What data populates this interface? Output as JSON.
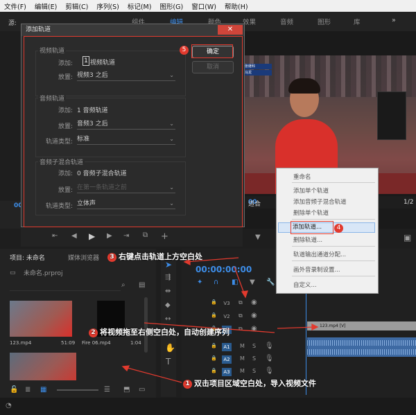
{
  "menubar": [
    "文件(F)",
    "编辑(E)",
    "剪辑(C)",
    "序列(S)",
    "标记(M)",
    "图形(G)",
    "窗口(W)",
    "帮助(H)"
  ],
  "workspace_tabs": {
    "items": [
      "组件",
      "编辑",
      "颜色",
      "效果",
      "音频",
      "图形",
      "库"
    ],
    "active": "编辑"
  },
  "source_tab": "源:",
  "dialog": {
    "title": "添加轨道",
    "close": "✕",
    "video": {
      "title": "视频轨道",
      "add_label": "添加:",
      "add_count": "1",
      "add_unit": "视频轨道",
      "place_label": "放置:",
      "place_value": "视频3 之后"
    },
    "audio": {
      "title": "音频轨道",
      "add_label": "添加:",
      "add_text": "1 音频轨道",
      "place_label": "放置:",
      "place_value": "音频3 之后",
      "type_label": "轨道类型:",
      "type_value": "标准"
    },
    "submix": {
      "title": "音频子混合轨道",
      "add_label": "添加:",
      "add_text": "0 音频子混合轨道",
      "place_label": "放置:",
      "place_value": "在第一条轨道之前",
      "type_label": "轨道类型:",
      "type_value": "立体声"
    },
    "ok_button": "确定",
    "cancel_button": "取消"
  },
  "program_monitor": {
    "timecode_left": "00",
    "fit": "适合",
    "ratio": "1/2",
    "scoreboard": [
      "张继科",
      "马龙"
    ]
  },
  "context_menu": {
    "items": [
      "重命名",
      "添加单个轨道",
      "添加音频子混合轨道",
      "删除单个轨道",
      "添加轨道...",
      "删除轨道...",
      "轨道输出通道分配...",
      "画外音录制设置...",
      "自定义..."
    ],
    "highlighted": "添加轨道..."
  },
  "project_panel": {
    "tab_project": "项目: 未命名",
    "tab_media": "媒体浏览器",
    "file": "未命名.prproj",
    "clips": [
      {
        "name": "123.mp4",
        "duration": "51:09"
      },
      {
        "name": "Fire 06.mp4",
        "duration": "1:04"
      }
    ]
  },
  "timeline": {
    "timecode": "00:00:00:00",
    "tracks": [
      {
        "name": "V3",
        "active": false
      },
      {
        "name": "V2",
        "active": false
      },
      {
        "name": "V1",
        "active": true
      },
      {
        "name": "A1",
        "active": true
      },
      {
        "name": "A2",
        "active": true
      },
      {
        "name": "A3",
        "active": true
      }
    ],
    "mute": "M",
    "solo": "S",
    "clip_label": "123.mp4 [V]"
  },
  "annotations": [
    {
      "num": "1",
      "text": "双击项目区域空白处，导入视频文件"
    },
    {
      "num": "2",
      "text": "将视频拖至右侧空白处，自动创建序列"
    },
    {
      "num": "3",
      "text": "右键点击轨道上方空白处"
    },
    {
      "num": "4",
      "text": ""
    },
    {
      "num": "5",
      "text": ""
    }
  ],
  "colors": {
    "accent": "#3d8de8",
    "annotation_red": "#e23a2e",
    "menu_bg": "#f0f0f0"
  }
}
